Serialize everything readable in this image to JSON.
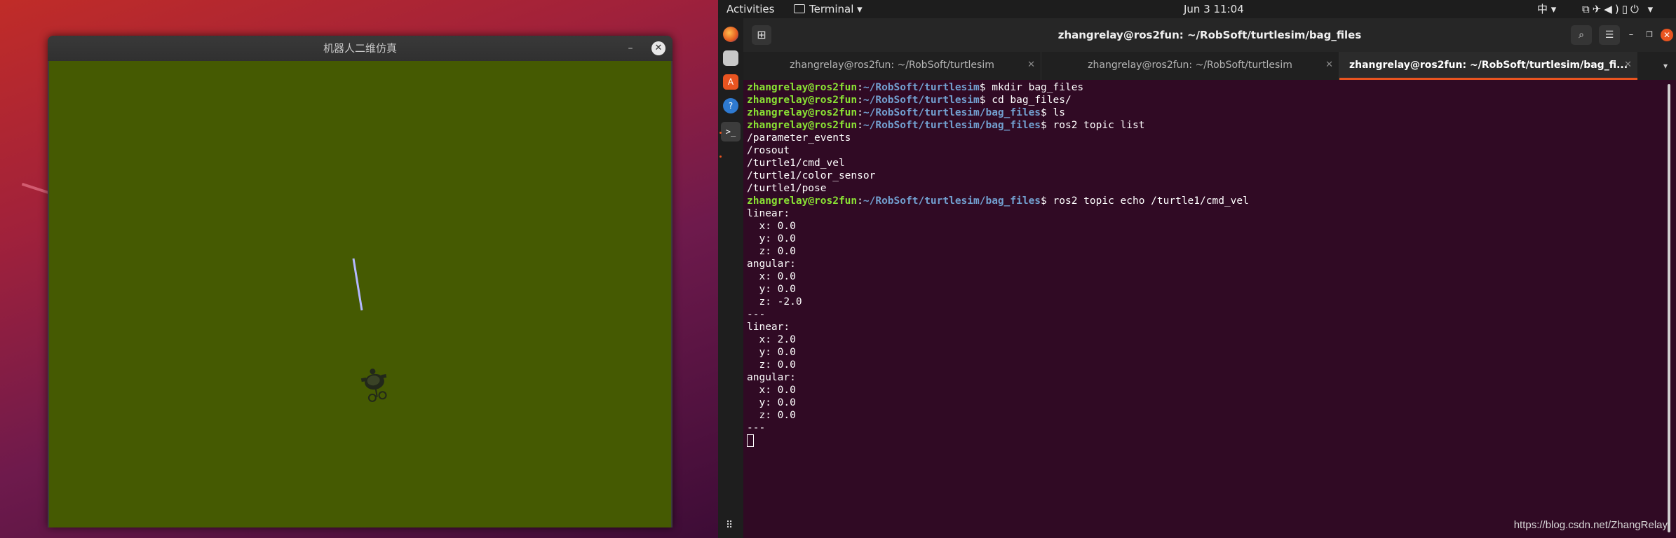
{
  "turtle_window": {
    "title": "机器人二维仿真",
    "minimize_icon": "minimize-icon",
    "close_icon": "close-icon",
    "canvas_color": "#455a02"
  },
  "topbar": {
    "activities": "Activities",
    "app_name": "Terminal",
    "clock": "Jun 3  11:04",
    "ime": "中",
    "icons": [
      "network-icon",
      "airplane-icon",
      "volume-icon",
      "battery-icon",
      "power-icon"
    ]
  },
  "dock": {
    "items": [
      "firefox-icon",
      "files-icon",
      "software-icon",
      "help-icon",
      "terminal-icon"
    ],
    "apps_grid_icon": "apps-grid-icon"
  },
  "terminal_window": {
    "title": "zhangrelay@ros2fun: ~/RobSoft/turtlesim/bag_files",
    "tabs": [
      {
        "label": "zhangrelay@ros2fun: ~/RobSoft/turtlesim"
      },
      {
        "label": "zhangrelay@ros2fun: ~/RobSoft/turtlesim"
      },
      {
        "label": "zhangrelay@ros2fun: ~/RobSoft/turtlesim/bag_fi..."
      }
    ],
    "active_tab": 2,
    "prompt_user": "zhangrelay@ros2fun",
    "lines": [
      {
        "type": "cmd",
        "path": "~/RobSoft/turtlesim",
        "cmd": "mkdir bag_files"
      },
      {
        "type": "cmd",
        "path": "~/RobSoft/turtlesim",
        "cmd": "cd bag_files/"
      },
      {
        "type": "cmd",
        "path": "~/RobSoft/turtlesim/bag_files",
        "cmd": "ls"
      },
      {
        "type": "cmd",
        "path": "~/RobSoft/turtlesim/bag_files",
        "cmd": "ros2 topic list"
      },
      {
        "type": "out",
        "text": "/parameter_events"
      },
      {
        "type": "out",
        "text": "/rosout"
      },
      {
        "type": "out",
        "text": "/turtle1/cmd_vel"
      },
      {
        "type": "out",
        "text": "/turtle1/color_sensor"
      },
      {
        "type": "out",
        "text": "/turtle1/pose"
      },
      {
        "type": "cmd",
        "path": "~/RobSoft/turtlesim/bag_files",
        "cmd": "ros2 topic echo /turtle1/cmd_vel"
      },
      {
        "type": "out",
        "text": "linear:"
      },
      {
        "type": "out",
        "text": "  x: 0.0"
      },
      {
        "type": "out",
        "text": "  y: 0.0"
      },
      {
        "type": "out",
        "text": "  z: 0.0"
      },
      {
        "type": "out",
        "text": "angular:"
      },
      {
        "type": "out",
        "text": "  x: 0.0"
      },
      {
        "type": "out",
        "text": "  y: 0.0"
      },
      {
        "type": "out",
        "text": "  z: -2.0"
      },
      {
        "type": "out",
        "text": "---"
      },
      {
        "type": "out",
        "text": "linear:"
      },
      {
        "type": "out",
        "text": "  x: 2.0"
      },
      {
        "type": "out",
        "text": "  y: 0.0"
      },
      {
        "type": "out",
        "text": "  z: 0.0"
      },
      {
        "type": "out",
        "text": "angular:"
      },
      {
        "type": "out",
        "text": "  x: 0.0"
      },
      {
        "type": "out",
        "text": "  y: 0.0"
      },
      {
        "type": "out",
        "text": "  z: 0.0"
      },
      {
        "type": "out",
        "text": "---"
      }
    ]
  },
  "watermark": "https://blog.csdn.net/ZhangRelay",
  "colors": {
    "terminal_bg": "#300a24",
    "prompt_user": "#8ae234",
    "prompt_path": "#729fcf",
    "accent": "#e95420"
  }
}
